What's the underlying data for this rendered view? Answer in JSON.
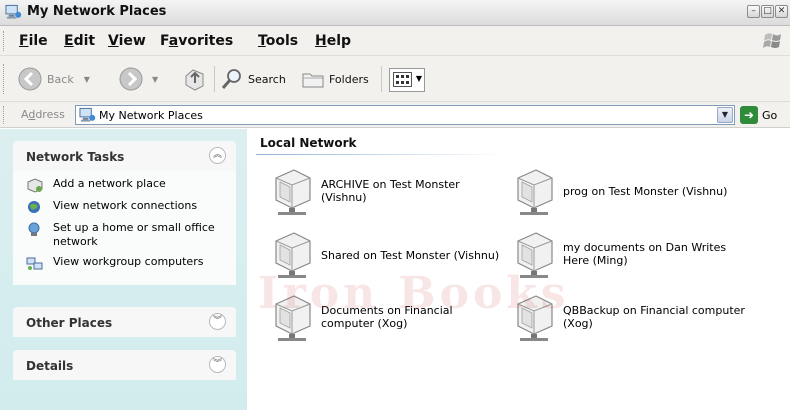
{
  "window": {
    "title": "My Network Places"
  },
  "menu": {
    "file": {
      "key": "F",
      "rest": "ile"
    },
    "edit": {
      "key": "E",
      "rest": "dit"
    },
    "view": {
      "key": "V",
      "rest": "iew"
    },
    "favorites": {
      "pre": "F",
      "key": "a",
      "rest": "vorites"
    },
    "tools": {
      "key": "T",
      "rest": "ools"
    },
    "help": {
      "key": "H",
      "rest": "elp"
    }
  },
  "toolbar": {
    "back": "Back",
    "search": "Search",
    "folders": "Folders"
  },
  "address": {
    "label_pre": "A",
    "label_key": "d",
    "label_rest": "dress",
    "value": "My Network Places",
    "go": "Go"
  },
  "sidebar": {
    "network_tasks": {
      "title": "Network Tasks",
      "items": [
        {
          "label": "Add a network place",
          "icon": "add-network-place-icon"
        },
        {
          "label": "View network connections",
          "icon": "network-connections-icon"
        },
        {
          "label": "Set up a home or small office network",
          "icon": "setup-network-icon"
        },
        {
          "label": "View workgroup computers",
          "icon": "workgroup-computers-icon"
        }
      ]
    },
    "other_places": {
      "title": "Other Places"
    },
    "details": {
      "title": "Details"
    }
  },
  "content": {
    "group_title": "Local Network",
    "items": [
      {
        "label": "ARCHIVE on Test Monster (Vishnu)"
      },
      {
        "label": "prog on Test Monster (Vishnu)"
      },
      {
        "label": "Shared on Test Monster (Vishnu)"
      },
      {
        "label": "my documents on Dan Writes Here (Ming)"
      },
      {
        "label": "Documents on Financial computer (Xog)"
      },
      {
        "label": "QBBackup on Financial computer (Xog)"
      }
    ]
  },
  "watermark": "Iron Books",
  "colors": {
    "sidebar_bg": "#d2ecee",
    "accent": "#2f8a3a",
    "title_bar": "#dcdcdc"
  }
}
